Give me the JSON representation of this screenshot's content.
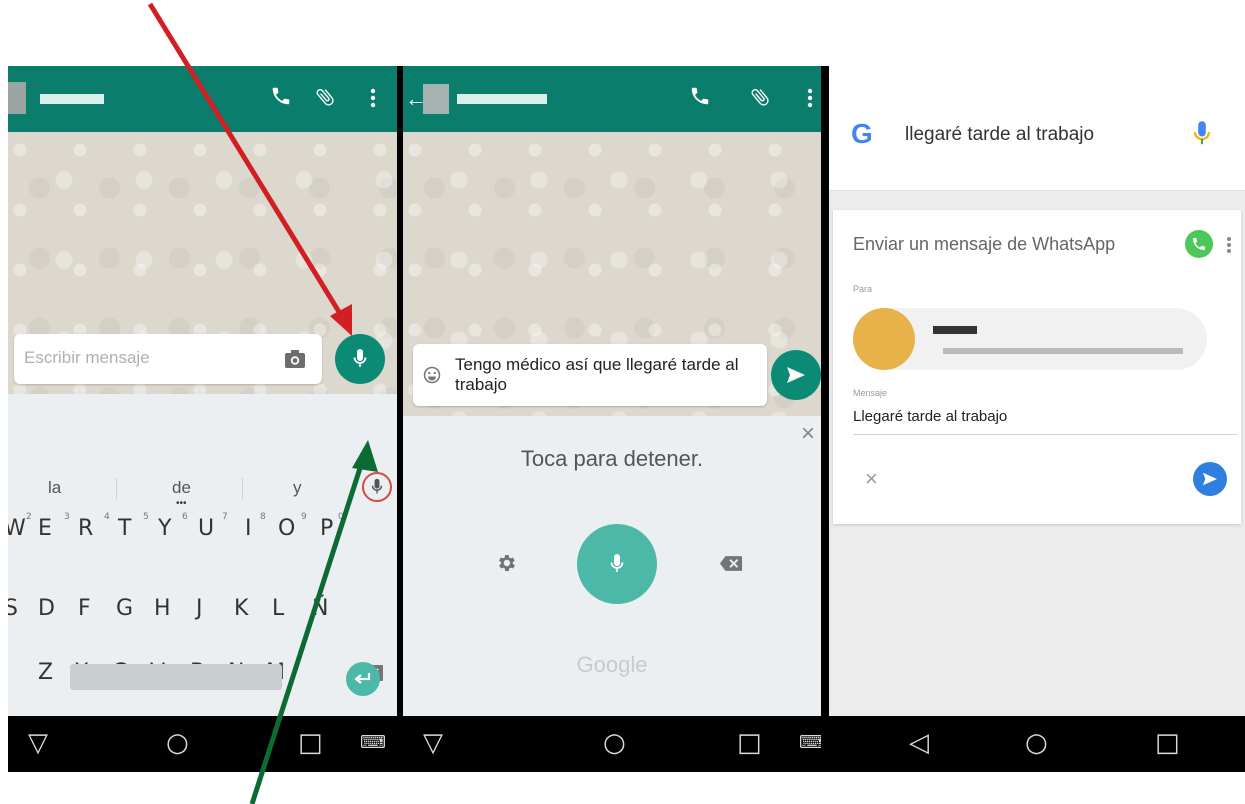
{
  "panel1": {
    "input_placeholder": "Escribir mensaje",
    "suggestions": [
      "la",
      "de",
      "y"
    ],
    "row1": [
      "W",
      "E",
      "R",
      "T",
      "Y",
      "U",
      "I",
      "O",
      "P"
    ],
    "row1_nums": [
      "2",
      "3",
      "4",
      "5",
      "6",
      "7",
      "8",
      "9",
      "0"
    ],
    "row2": [
      "S",
      "D",
      "F",
      "G",
      "H",
      "J",
      "K",
      "L",
      "Ñ"
    ],
    "row3": [
      "Z",
      "X",
      "C",
      "V",
      "B",
      "N",
      "M"
    ],
    "comma": ","
  },
  "panel2": {
    "message_text": "Tengo médico así que llegaré tarde al trabajo",
    "listening_text": "Toca para detener.",
    "google_label": "Google",
    "close_glyph": "×"
  },
  "panel3": {
    "search_query": "llegaré tarde al trabajo",
    "card_title": "Enviar un mensaje de WhatsApp",
    "to_label": "Para",
    "message_label": "Mensaje",
    "message_value": "Llegaré tarde al trabajo",
    "cancel_glyph": "×",
    "google_g": "G"
  },
  "colors": {
    "whatsapp_green": "#0b7d6c",
    "accent_teal": "#4cb8a8",
    "red_arrow": "#d21f24",
    "green_arrow": "#0b6b32",
    "send_blue": "#2f7fe0"
  },
  "icons": [
    "phone-icon",
    "attach-icon",
    "more-vert-icon",
    "camera-icon",
    "mic-icon",
    "emoji-icon",
    "send-icon",
    "gear-icon",
    "backspace-icon",
    "whatsapp-icon",
    "back-icon",
    "home-icon",
    "recents-icon",
    "keyboard-icon"
  ]
}
